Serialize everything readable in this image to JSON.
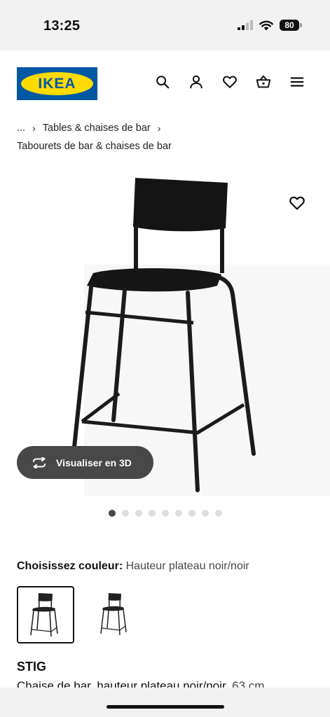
{
  "status_bar": {
    "time": "13:25",
    "battery": "80",
    "icons": [
      "signal-icon",
      "wifi-icon",
      "battery-icon"
    ]
  },
  "header": {
    "logo_text": "IKEA",
    "icons": [
      "search-icon",
      "account-icon",
      "wishlist-icon",
      "cart-icon",
      "menu-icon"
    ]
  },
  "breadcrumb": {
    "ellipsis": "...",
    "level1": "Tables & chaises de bar",
    "level2": "Tabourets de bar & chaises de bar"
  },
  "gallery": {
    "view3d_label": "Visualiser en 3D",
    "dot_count": 9,
    "active_dot": 1
  },
  "color": {
    "label": "Choisissez couleur:",
    "value": "Hauteur plateau noir/noir"
  },
  "product": {
    "name": "STIG",
    "description": "Chaise de bar, hauteur plateau noir/noir,",
    "dimension": "63 cm"
  },
  "colors": {
    "logo_blue": "#0058a3",
    "logo_yellow": "#ffdb00",
    "button_dark": "#484848"
  }
}
